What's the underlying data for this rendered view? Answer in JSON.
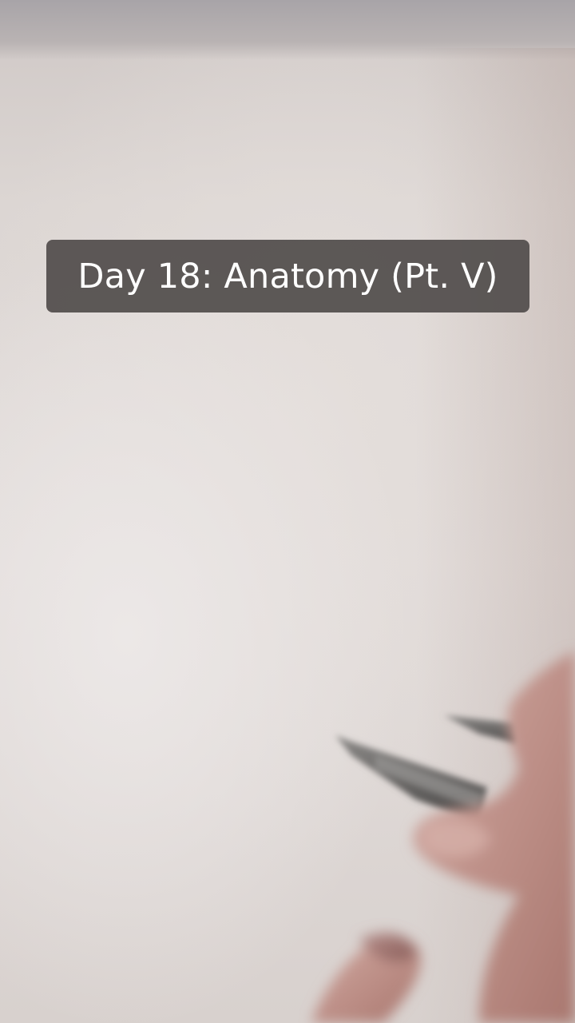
{
  "overlay": {
    "caption": "Day 18: Anatomy (Pt. V)"
  },
  "scene": {
    "background_color": "#e2dcda",
    "caption_box_color": "#504c4b",
    "caption_text_color": "#ffffff",
    "skin_color": "#c49a92",
    "pen_color": "#6a6866"
  }
}
